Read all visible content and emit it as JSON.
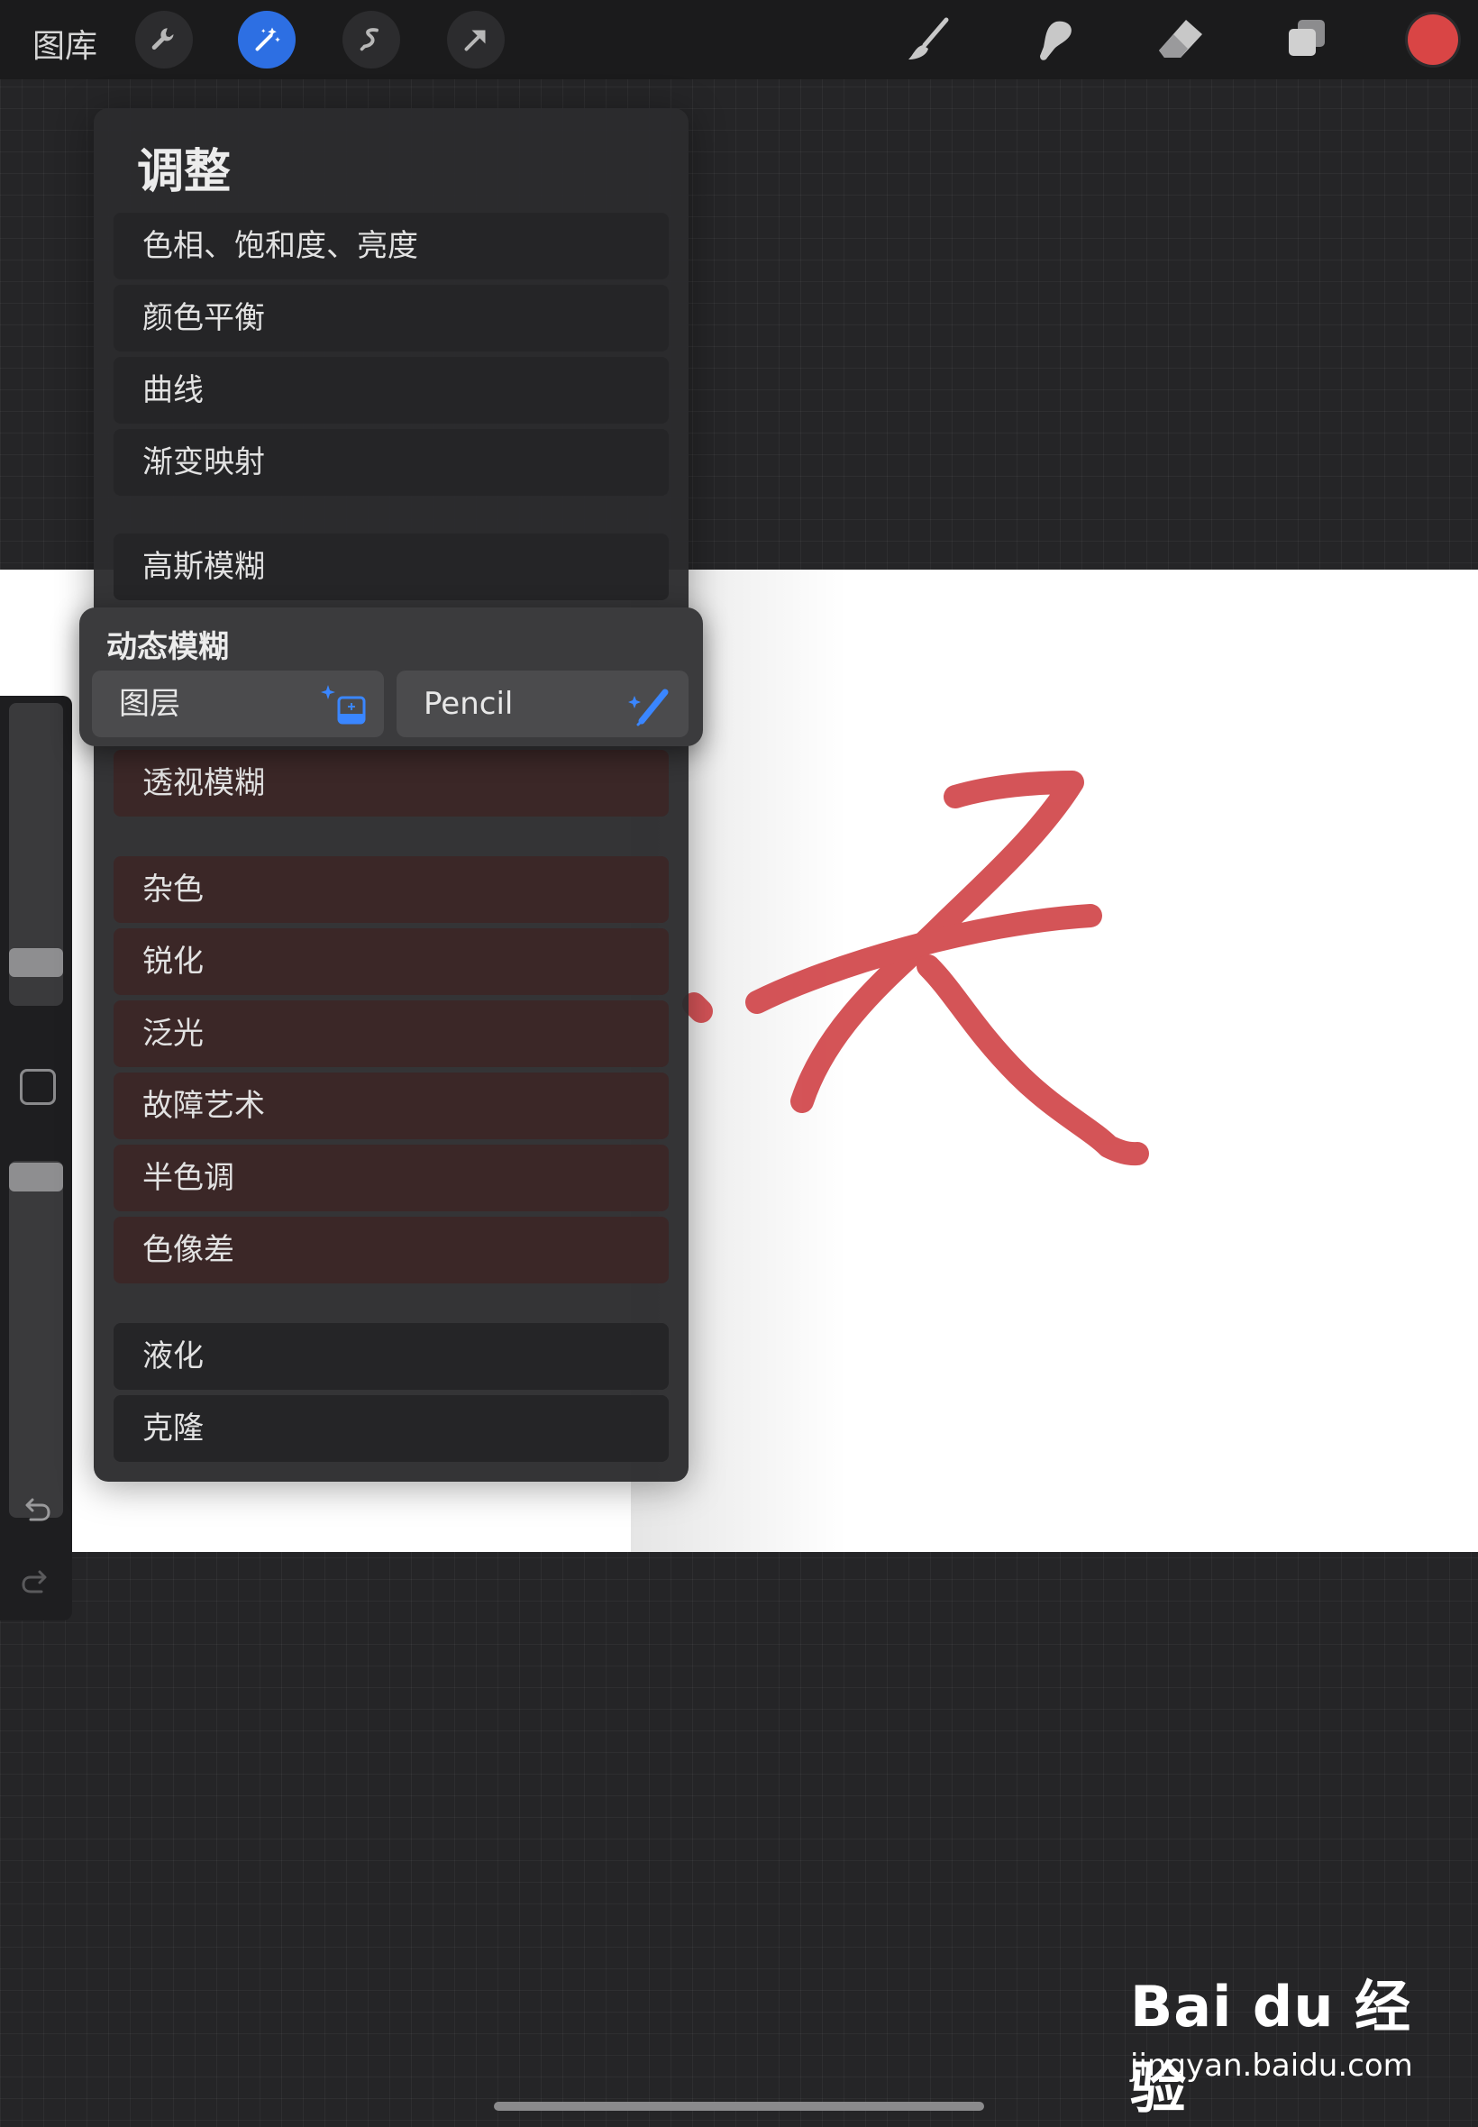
{
  "toolbar": {
    "gallery_label": "图库",
    "left_tools": [
      {
        "name": "actions",
        "icon": "wrench-icon"
      },
      {
        "name": "adjustments",
        "icon": "magic-wand-icon",
        "active": true
      },
      {
        "name": "selection",
        "icon": "selection-s-icon"
      },
      {
        "name": "transform",
        "icon": "arrow-icon"
      }
    ],
    "right_tools": [
      {
        "name": "brush",
        "icon": "brush-icon"
      },
      {
        "name": "smudge",
        "icon": "smudge-icon"
      },
      {
        "name": "eraser",
        "icon": "eraser-icon"
      },
      {
        "name": "layers",
        "icon": "layers-icon"
      }
    ],
    "current_color": "#d94545"
  },
  "panel": {
    "title": "调整",
    "items": [
      "色相、饱和度、亮度",
      "颜色平衡",
      "曲线",
      "渐变映射",
      "高斯模糊",
      "透视模糊",
      "杂色",
      "锐化",
      "泛光",
      "故障艺术",
      "半色调",
      "色像差",
      "液化",
      "克隆"
    ]
  },
  "popup": {
    "title": "动态模糊",
    "options": [
      {
        "label": "图层",
        "icon": "sparkle-layer-icon"
      },
      {
        "label": "Pencil",
        "icon": "sparkle-pencil-icon"
      }
    ]
  },
  "sidebar": {
    "icons": [
      "undo-icon",
      "redo-icon"
    ]
  },
  "watermark": {
    "brand": "Bai du 经验",
    "url": "jingyan.baidu.com"
  },
  "colors": {
    "accent": "#2d6fe3",
    "stroke": "#d24b4f"
  }
}
